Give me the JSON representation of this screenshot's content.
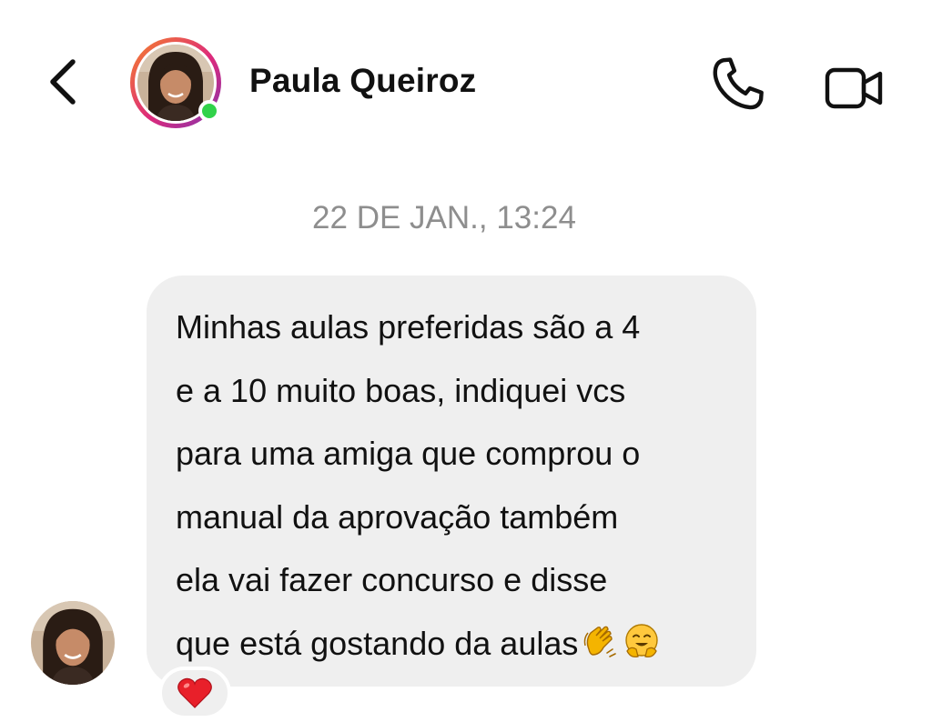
{
  "header": {
    "contact_name": "Paula Queiroz",
    "online": true
  },
  "conversation": {
    "timestamp": "22 DE JAN., 13:24",
    "message": {
      "lines": [
        "Minhas aulas preferidas são a 4",
        "e a 10 muito boas, indiquei vcs",
        "para uma amiga que comprou o",
        "manual da aprovação também",
        "ela vai fazer concurso e disse",
        "que está gostando da aulas"
      ],
      "trailing_emojis": [
        "clapping-hands-emoji",
        "hugging-face-emoji"
      ],
      "reaction": "red-heart-emoji"
    }
  },
  "icons": {
    "back": "chevron-left-icon",
    "call": "phone-icon",
    "video": "video-camera-icon"
  },
  "colors": {
    "bubble_bg": "#efefef",
    "online_green": "#31d24a",
    "timestamp_gray": "#8e8e8e",
    "text": "#111111"
  }
}
